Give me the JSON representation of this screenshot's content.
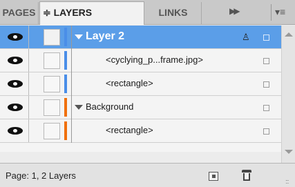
{
  "tabs": {
    "pages": "PAGES",
    "layers": "≑ LAYERS",
    "links": "LINKS"
  },
  "tab_controls": {
    "collapse_glyph": "▶▶",
    "menu_glyph": "▾≡"
  },
  "layers": [
    {
      "label": "Layer 2",
      "kind": "layer",
      "expanded": true,
      "selected": true,
      "visible": true,
      "color": "#4a8ee8",
      "pen_glyph": "♙"
    },
    {
      "label": "<cyclying_p...frame.jpg>",
      "kind": "object",
      "selected": false,
      "visible": true,
      "color": "#4a8ee8"
    },
    {
      "label": "<rectangle>",
      "kind": "object",
      "selected": false,
      "visible": true,
      "color": "#4a8ee8"
    },
    {
      "label": "Background",
      "kind": "layer",
      "expanded": true,
      "selected": false,
      "visible": true,
      "color": "#f0700a"
    },
    {
      "label": "<rectangle>",
      "kind": "object",
      "selected": false,
      "visible": true,
      "color": "#f0700a"
    }
  ],
  "footer": {
    "status": "Page: 1, 2 Layers"
  },
  "colors": {
    "selection": "#5b9ee8",
    "layer2": "#4a8ee8",
    "background_layer": "#f0700a"
  }
}
